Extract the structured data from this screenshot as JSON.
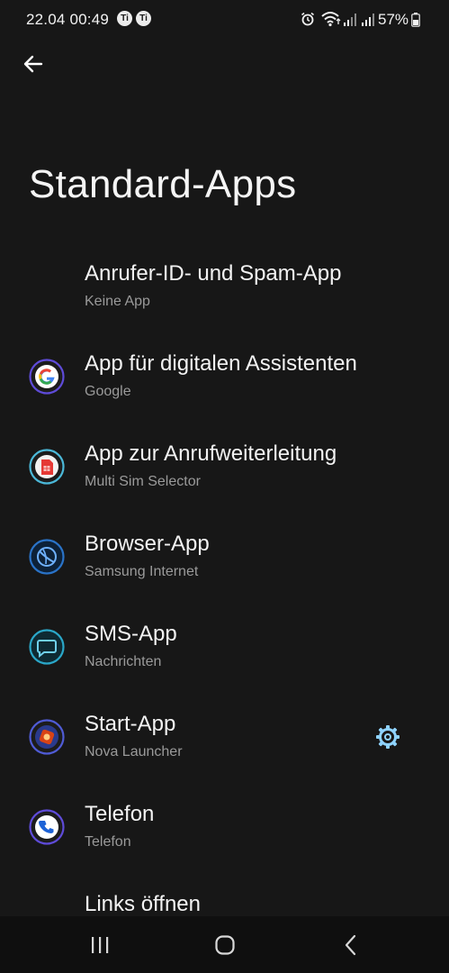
{
  "status_bar": {
    "time": "22.04 00:49",
    "notif_icon_1": "Ti",
    "notif_icon_2": "Ti",
    "battery_percent": "57%",
    "icons": [
      "alarm-icon",
      "wifi-icon",
      "signal-icon",
      "signal-icon",
      "battery-icon"
    ]
  },
  "header": {
    "back_icon": "back-arrow-icon",
    "title": "Standard-Apps"
  },
  "items": [
    {
      "title": "Anrufer-ID- und Spam-App",
      "subtitle": "Keine App",
      "icon": "none"
    },
    {
      "title": "App für digitalen Assistenten",
      "subtitle": "Google",
      "icon": "google-icon"
    },
    {
      "title": "App zur Anrufweiterleitung",
      "subtitle": "Multi Sim Selector",
      "icon": "sim-card-icon"
    },
    {
      "title": "Browser-App",
      "subtitle": "Samsung Internet",
      "icon": "samsung-internet-icon"
    },
    {
      "title": "SMS-App",
      "subtitle": "Nachrichten",
      "icon": "messages-icon"
    },
    {
      "title": "Start-App",
      "subtitle": "Nova Launcher",
      "icon": "nova-launcher-icon",
      "has_settings": true
    },
    {
      "title": "Telefon",
      "subtitle": "Telefon",
      "icon": "phone-icon"
    },
    {
      "title": "Links öffnen",
      "subtitle": "",
      "icon": "none"
    }
  ],
  "nav_bar": {
    "recents_icon": "recents-icon",
    "home_icon": "home-icon",
    "back_icon": "nav-back-icon"
  },
  "colors": {
    "background": "#171717",
    "nav_background": "#0f0f0f",
    "text_primary": "#f3f3f3",
    "text_secondary": "#9a9a9a",
    "accent_gear": "#8fd3ff"
  }
}
